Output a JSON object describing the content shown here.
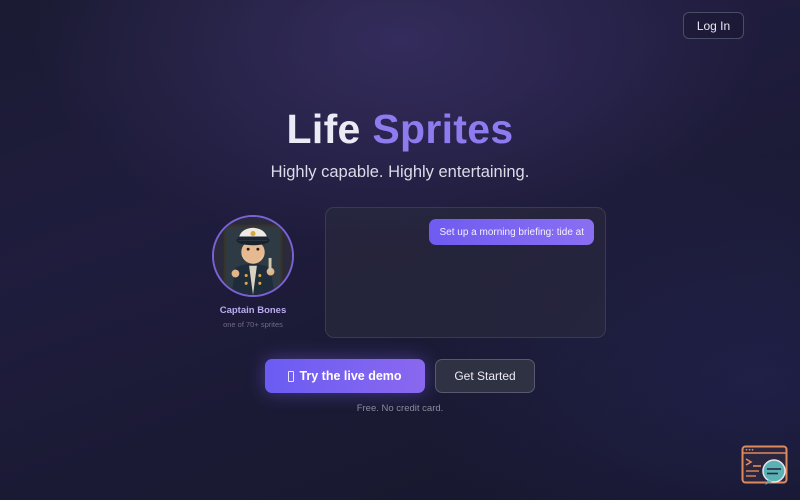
{
  "header": {
    "login_label": "Log In"
  },
  "hero": {
    "title_part1": "Life",
    "title_part2": "Sprites",
    "tagline": "Highly capable. Highly entertaining."
  },
  "sprite": {
    "name": "Captain Bones",
    "subtitle": "one of 70+ sprites",
    "avatar_icon": "captain-avatar"
  },
  "chat": {
    "message": "Set up a morning briefing: tide at"
  },
  "cta": {
    "primary_label": "Try the live demo",
    "secondary_label": "Get Started",
    "fineprint": "Free. No credit card."
  },
  "colors": {
    "accent": "#7c66f0",
    "accent_light": "#8f7bf0",
    "background": "#1d1c38"
  },
  "widget": {
    "icon": "terminal-chat-icon"
  }
}
